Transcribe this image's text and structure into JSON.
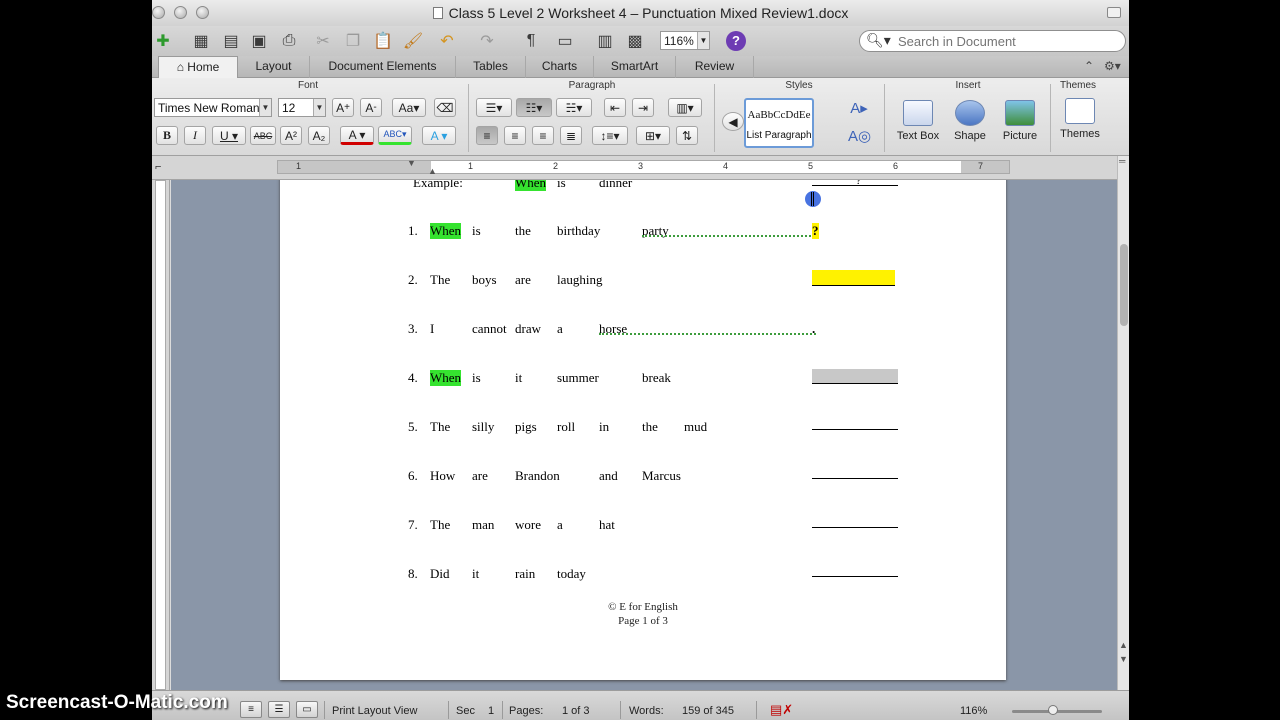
{
  "window": {
    "title": "Class 5 Level 2 Worksheet 4 – Punctuation Mixed Review1.docx"
  },
  "toolbar": {
    "zoom": "116%",
    "help": "?",
    "search_placeholder": "Search in Document"
  },
  "ribbon_tabs": [
    "Home",
    "Layout",
    "Document Elements",
    "Tables",
    "Charts",
    "SmartArt",
    "Review"
  ],
  "ribbon": {
    "groups": [
      "Font",
      "Paragraph",
      "Styles",
      "Insert",
      "Themes"
    ],
    "font_name": "Times New Roman",
    "font_size": "12",
    "style_sample": "AaBbCcDdEe",
    "style_name": "List Paragraph",
    "insert_buttons": [
      "Text Box",
      "Shape",
      "Picture"
    ],
    "themes_button": "Themes"
  },
  "ruler": {
    "numbers": [
      "1",
      "1",
      "2",
      "3",
      "4",
      "5",
      "6",
      "7"
    ]
  },
  "document": {
    "example": {
      "label": "Example:",
      "words": [
        "When",
        "is",
        "dinner"
      ],
      "answer": "?"
    },
    "items": [
      {
        "num": "1.",
        "words": [
          "When",
          "is",
          "the",
          "birthday",
          "party"
        ],
        "answer": "?"
      },
      {
        "num": "2.",
        "words": [
          "The",
          "boys",
          "are",
          "laughing"
        ],
        "answer": ""
      },
      {
        "num": "3.",
        "words": [
          "I",
          "cannot",
          "draw",
          "a",
          "horse"
        ],
        "answer": "."
      },
      {
        "num": "4.",
        "words": [
          "When",
          "is",
          "it",
          "summer",
          "break"
        ],
        "answer": ""
      },
      {
        "num": "5.",
        "words": [
          "The",
          "silly",
          "pigs",
          "roll",
          "in",
          "the",
          "mud"
        ],
        "answer": ""
      },
      {
        "num": "6.",
        "words": [
          "How",
          "are",
          "Brandon",
          "and",
          "Marcus"
        ],
        "answer": ""
      },
      {
        "num": "7.",
        "words": [
          "The",
          "man",
          "wore",
          "a",
          "hat"
        ],
        "answer": ""
      },
      {
        "num": "8.",
        "words": [
          "Did",
          "it",
          "rain",
          "today"
        ],
        "answer": ""
      }
    ],
    "footer_line1": "© E for English",
    "footer_line2": "Page 1 of 3"
  },
  "status": {
    "view": "Print Layout View",
    "sec_label": "Sec",
    "sec_value": "1",
    "pages_label": "Pages:",
    "pages_value": "1 of 3",
    "words_label": "Words:",
    "words_value": "159 of 345",
    "zoom": "116%"
  },
  "watermark": "Screencast-O-Matic.com",
  "colors": {
    "highlight_green": "#35e32f",
    "highlight_yellow": "#fff200",
    "help_purple": "#6d3cb3",
    "cursor_blue": "#285adc"
  }
}
